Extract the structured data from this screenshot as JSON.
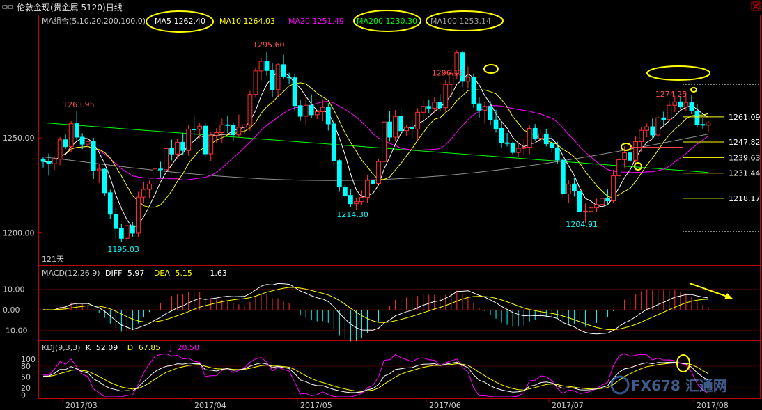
{
  "window": {
    "title": "伦敦金现(贵金属 5120)日线",
    "menu_icon": "window-menu-icon",
    "close_icon": "close-icon"
  },
  "legend_main": {
    "label": "MA组合(5,10,20,200,100,0)",
    "items": [
      {
        "name": "MA5",
        "value": "1262.40",
        "color": "#ffffff"
      },
      {
        "name": "MA10",
        "value": "1264.03",
        "color": "#ffff00"
      },
      {
        "name": "MA20",
        "value": "1251.49",
        "color": "#ff00ff"
      },
      {
        "name": "MA200",
        "value": "1230.30",
        "color": "#00ff00"
      },
      {
        "name": "MA100",
        "value": "1253.14",
        "color": "#808080"
      }
    ]
  },
  "legend_macd": {
    "label": "MACD(12,26,9)",
    "diff_label": "DIFF",
    "diff": "5.97",
    "dea_label": "DEA",
    "dea": "5.15",
    "macd": "1.63"
  },
  "legend_kdj": {
    "label": "KDJ(9,3,3)",
    "k_label": "K",
    "k": "52.09",
    "d_label": "D",
    "d": "67.85",
    "j_label": "J",
    "j": "20.58"
  },
  "period_label": "121天",
  "watermark": "FX678 汇通网",
  "colors": {
    "up": "#ff3232",
    "down": "#00ffff",
    "bg": "#000000",
    "axis": "#c00000",
    "ma5": "#ffffff",
    "ma10": "#ffff00",
    "ma20": "#ff00ff",
    "ma100": "#909090",
    "ma200": "#00ff00",
    "highlight": "#ffff00"
  },
  "chart_data": {
    "type": "candlestick",
    "price_axis": {
      "ticks": [
        1250.0,
        1200.0
      ],
      "ylim": [
        1184,
        1308
      ]
    },
    "macd_axis": {
      "ticks": [
        10.0,
        0.0,
        -10.0
      ],
      "ylim": [
        -14,
        16
      ]
    },
    "kdj_axis": {
      "ticks": [
        100,
        80,
        50,
        20,
        0
      ],
      "ylim": [
        -5,
        115
      ]
    },
    "x_labels": [
      "2017/03",
      "2017/04",
      "2017/05",
      "2017/06",
      "2017/07",
      "2017/08"
    ],
    "extreme_labels": [
      {
        "text": "1263.95",
        "color": "#ff5050"
      },
      {
        "text": "1195.03",
        "color": "#00ffff"
      },
      {
        "text": "1295.60",
        "color": "#ff5050"
      },
      {
        "text": "1214.30",
        "color": "#00ffff"
      },
      {
        "text": "1296.13",
        "color": "#ff5050"
      },
      {
        "text": "1204.91",
        "color": "#00ffff"
      },
      {
        "text": "1274.25",
        "color": "#ff5050"
      }
    ],
    "levels": [
      1261.09,
      1247.82,
      1239.63,
      1231.44,
      1218.17
    ],
    "candles": [
      [
        1238.7,
        1240.0,
        1234.4,
        1237.6
      ],
      [
        1237.6,
        1241.8,
        1230.1,
        1236.4
      ],
      [
        1236.4,
        1240.4,
        1233.0,
        1238.8
      ],
      [
        1238.8,
        1250.5,
        1235.6,
        1249.0
      ],
      [
        1249.0,
        1251.8,
        1244.1,
        1245.4
      ],
      [
        1245.4,
        1258.9,
        1242.3,
        1257.5
      ],
      [
        1257.5,
        1263.9,
        1248.3,
        1250.4
      ],
      [
        1250.4,
        1252.5,
        1244.1,
        1246.7
      ],
      [
        1246.7,
        1249.8,
        1244.6,
        1248.1
      ],
      [
        1248.1,
        1250.0,
        1228.4,
        1232.8
      ],
      [
        1232.8,
        1236.2,
        1226.1,
        1233.5
      ],
      [
        1233.5,
        1233.9,
        1219.3,
        1221.1
      ],
      [
        1221.1,
        1222.7,
        1207.3,
        1209.8
      ],
      [
        1209.8,
        1213.3,
        1197.2,
        1202.3
      ],
      [
        1202.3,
        1204.6,
        1195.0,
        1197.1
      ],
      [
        1197.1,
        1205.0,
        1195.6,
        1203.8
      ],
      [
        1203.8,
        1205.7,
        1197.6,
        1199.8
      ],
      [
        1199.8,
        1221.6,
        1197.9,
        1218.8
      ],
      [
        1218.8,
        1227.0,
        1215.7,
        1222.9
      ],
      [
        1222.9,
        1227.5,
        1218.1,
        1225.7
      ],
      [
        1225.7,
        1236.4,
        1220.1,
        1233.6
      ],
      [
        1233.6,
        1237.4,
        1229.1,
        1233.2
      ],
      [
        1233.2,
        1248.3,
        1231.9,
        1244.4
      ],
      [
        1244.4,
        1249.1,
        1238.1,
        1241.5
      ],
      [
        1241.5,
        1249.4,
        1239.1,
        1247.7
      ],
      [
        1247.7,
        1252.4,
        1240.8,
        1243.4
      ],
      [
        1243.4,
        1256.7,
        1240.6,
        1254.6
      ],
      [
        1254.6,
        1261.9,
        1250.3,
        1254.5
      ],
      [
        1254.5,
        1257.9,
        1249.8,
        1256.2
      ],
      [
        1256.2,
        1257.7,
        1240.2,
        1241.6
      ],
      [
        1241.6,
        1253.2,
        1237.6,
        1251.4
      ],
      [
        1251.4,
        1255.1,
        1247.5,
        1252.8
      ],
      [
        1252.8,
        1260.1,
        1247.0,
        1256.9
      ],
      [
        1256.9,
        1261.8,
        1252.5,
        1256.8
      ],
      [
        1256.8,
        1258.1,
        1248.4,
        1251.6
      ],
      [
        1251.6,
        1262.3,
        1250.3,
        1255.6
      ],
      [
        1255.6,
        1257.2,
        1251.8,
        1256.9
      ],
      [
        1256.9,
        1274.8,
        1253.8,
        1272.9
      ],
      [
        1272.9,
        1287.2,
        1271.2,
        1285.3
      ],
      [
        1285.3,
        1291.9,
        1280.2,
        1290.4
      ],
      [
        1290.4,
        1295.6,
        1282.8,
        1285.5
      ],
      [
        1285.5,
        1289.4,
        1271.4,
        1275.4
      ],
      [
        1275.4,
        1289.6,
        1272.0,
        1288.6
      ],
      [
        1288.6,
        1293.9,
        1281.0,
        1282.2
      ],
      [
        1282.2,
        1284.3,
        1278.5,
        1281.7
      ],
      [
        1281.7,
        1283.5,
        1264.0,
        1267.0
      ],
      [
        1267.0,
        1269.8,
        1259.0,
        1261.4
      ],
      [
        1261.4,
        1271.2,
        1256.5,
        1267.2
      ],
      [
        1267.2,
        1272.9,
        1260.6,
        1262.2
      ],
      [
        1262.2,
        1264.3,
        1259.9,
        1263.8
      ],
      [
        1263.8,
        1270.4,
        1258.8,
        1266.1
      ],
      [
        1266.1,
        1268.3,
        1253.9,
        1257.4
      ],
      [
        1257.4,
        1260.3,
        1235.3,
        1238.0
      ],
      [
        1238.0,
        1238.6,
        1221.6,
        1224.2
      ],
      [
        1224.2,
        1225.6,
        1218.3,
        1219.7
      ],
      [
        1219.7,
        1223.1,
        1213.4,
        1215.3
      ],
      [
        1215.3,
        1218.3,
        1211.9,
        1216.4
      ],
      [
        1216.4,
        1222.4,
        1214.7,
        1218.6
      ],
      [
        1218.6,
        1230.3,
        1215.9,
        1227.6
      ],
      [
        1227.6,
        1229.8,
        1224.7,
        1226.0
      ],
      [
        1226.0,
        1239.0,
        1225.8,
        1237.5
      ],
      [
        1237.5,
        1259.7,
        1237.4,
        1258.4
      ],
      [
        1258.4,
        1264.2,
        1248.1,
        1250.4
      ],
      [
        1250.4,
        1264.7,
        1248.2,
        1261.3
      ],
      [
        1261.3,
        1265.9,
        1251.8,
        1253.8
      ],
      [
        1253.8,
        1257.0,
        1251.0,
        1255.5
      ],
      [
        1255.5,
        1260.0,
        1250.1,
        1254.7
      ],
      [
        1254.7,
        1265.7,
        1248.8,
        1263.5
      ],
      [
        1263.5,
        1269.8,
        1257.5,
        1266.6
      ],
      [
        1266.6,
        1270.1,
        1262.9,
        1265.7
      ],
      [
        1265.7,
        1271.3,
        1263.1,
        1268.8
      ],
      [
        1268.8,
        1273.0,
        1264.2,
        1265.9
      ],
      [
        1265.9,
        1280.6,
        1263.8,
        1278.2
      ],
      [
        1278.2,
        1286.3,
        1271.4,
        1284.0
      ],
      [
        1284.0,
        1296.1,
        1281.0,
        1294.9
      ],
      [
        1294.9,
        1295.9,
        1276.7,
        1279.8
      ],
      [
        1279.8,
        1287.6,
        1275.9,
        1282.0
      ],
      [
        1282.0,
        1283.9,
        1265.9,
        1268.0
      ],
      [
        1268.0,
        1271.3,
        1260.6,
        1264.6
      ],
      [
        1264.6,
        1269.0,
        1257.6,
        1266.6
      ],
      [
        1266.6,
        1269.5,
        1257.0,
        1259.5
      ],
      [
        1259.5,
        1264.8,
        1252.8,
        1255.0
      ],
      [
        1255.0,
        1257.7,
        1245.0,
        1247.4
      ],
      [
        1247.4,
        1252.6,
        1245.5,
        1247.2
      ],
      [
        1247.2,
        1248.1,
        1241.0,
        1242.3
      ],
      [
        1242.3,
        1247.6,
        1239.9,
        1244.5
      ],
      [
        1244.5,
        1249.4,
        1240.8,
        1245.1
      ],
      [
        1245.1,
        1256.8,
        1241.4,
        1255.0
      ],
      [
        1255.0,
        1257.3,
        1248.7,
        1249.8
      ],
      [
        1249.8,
        1254.6,
        1247.8,
        1252.1
      ],
      [
        1252.1,
        1254.9,
        1245.5,
        1246.9
      ],
      [
        1246.9,
        1251.2,
        1242.5,
        1244.8
      ],
      [
        1244.8,
        1248.0,
        1236.5,
        1238.3
      ],
      [
        1238.3,
        1240.3,
        1218.7,
        1220.5
      ],
      [
        1220.5,
        1227.6,
        1215.6,
        1225.7
      ],
      [
        1225.7,
        1228.9,
        1219.1,
        1222.0
      ],
      [
        1222.0,
        1224.7,
        1208.3,
        1211.0
      ],
      [
        1211.0,
        1215.4,
        1204.9,
        1211.4
      ],
      [
        1211.4,
        1216.3,
        1207.1,
        1213.1
      ],
      [
        1213.1,
        1218.0,
        1210.9,
        1214.9
      ],
      [
        1214.9,
        1220.7,
        1213.1,
        1218.1
      ],
      [
        1218.1,
        1222.8,
        1214.6,
        1216.8
      ],
      [
        1216.8,
        1233.2,
        1215.8,
        1230.0
      ],
      [
        1230.0,
        1239.8,
        1228.5,
        1238.5
      ],
      [
        1238.5,
        1245.5,
        1234.4,
        1242.1
      ],
      [
        1242.1,
        1246.3,
        1237.1,
        1238.2
      ],
      [
        1238.2,
        1250.9,
        1236.0,
        1248.0
      ],
      [
        1248.0,
        1255.6,
        1242.6,
        1254.0
      ],
      [
        1254.0,
        1257.6,
        1250.3,
        1255.9
      ],
      [
        1255.9,
        1260.2,
        1249.6,
        1251.5
      ],
      [
        1251.5,
        1261.5,
        1250.6,
        1260.6
      ],
      [
        1260.6,
        1263.8,
        1257.0,
        1259.7
      ],
      [
        1259.7,
        1269.4,
        1258.6,
        1267.2
      ],
      [
        1267.2,
        1272.2,
        1263.6,
        1269.0
      ],
      [
        1269.0,
        1271.7,
        1265.1,
        1266.3
      ],
      [
        1266.3,
        1274.2,
        1264.2,
        1268.7
      ],
      [
        1268.7,
        1272.6,
        1262.5,
        1264.2
      ],
      [
        1264.2,
        1267.6,
        1255.5,
        1257.1
      ],
      [
        1257.1,
        1260.3,
        1254.9,
        1256.7
      ],
      [
        1256.7,
        1258.8,
        1253.2,
        1258.0
      ]
    ]
  }
}
